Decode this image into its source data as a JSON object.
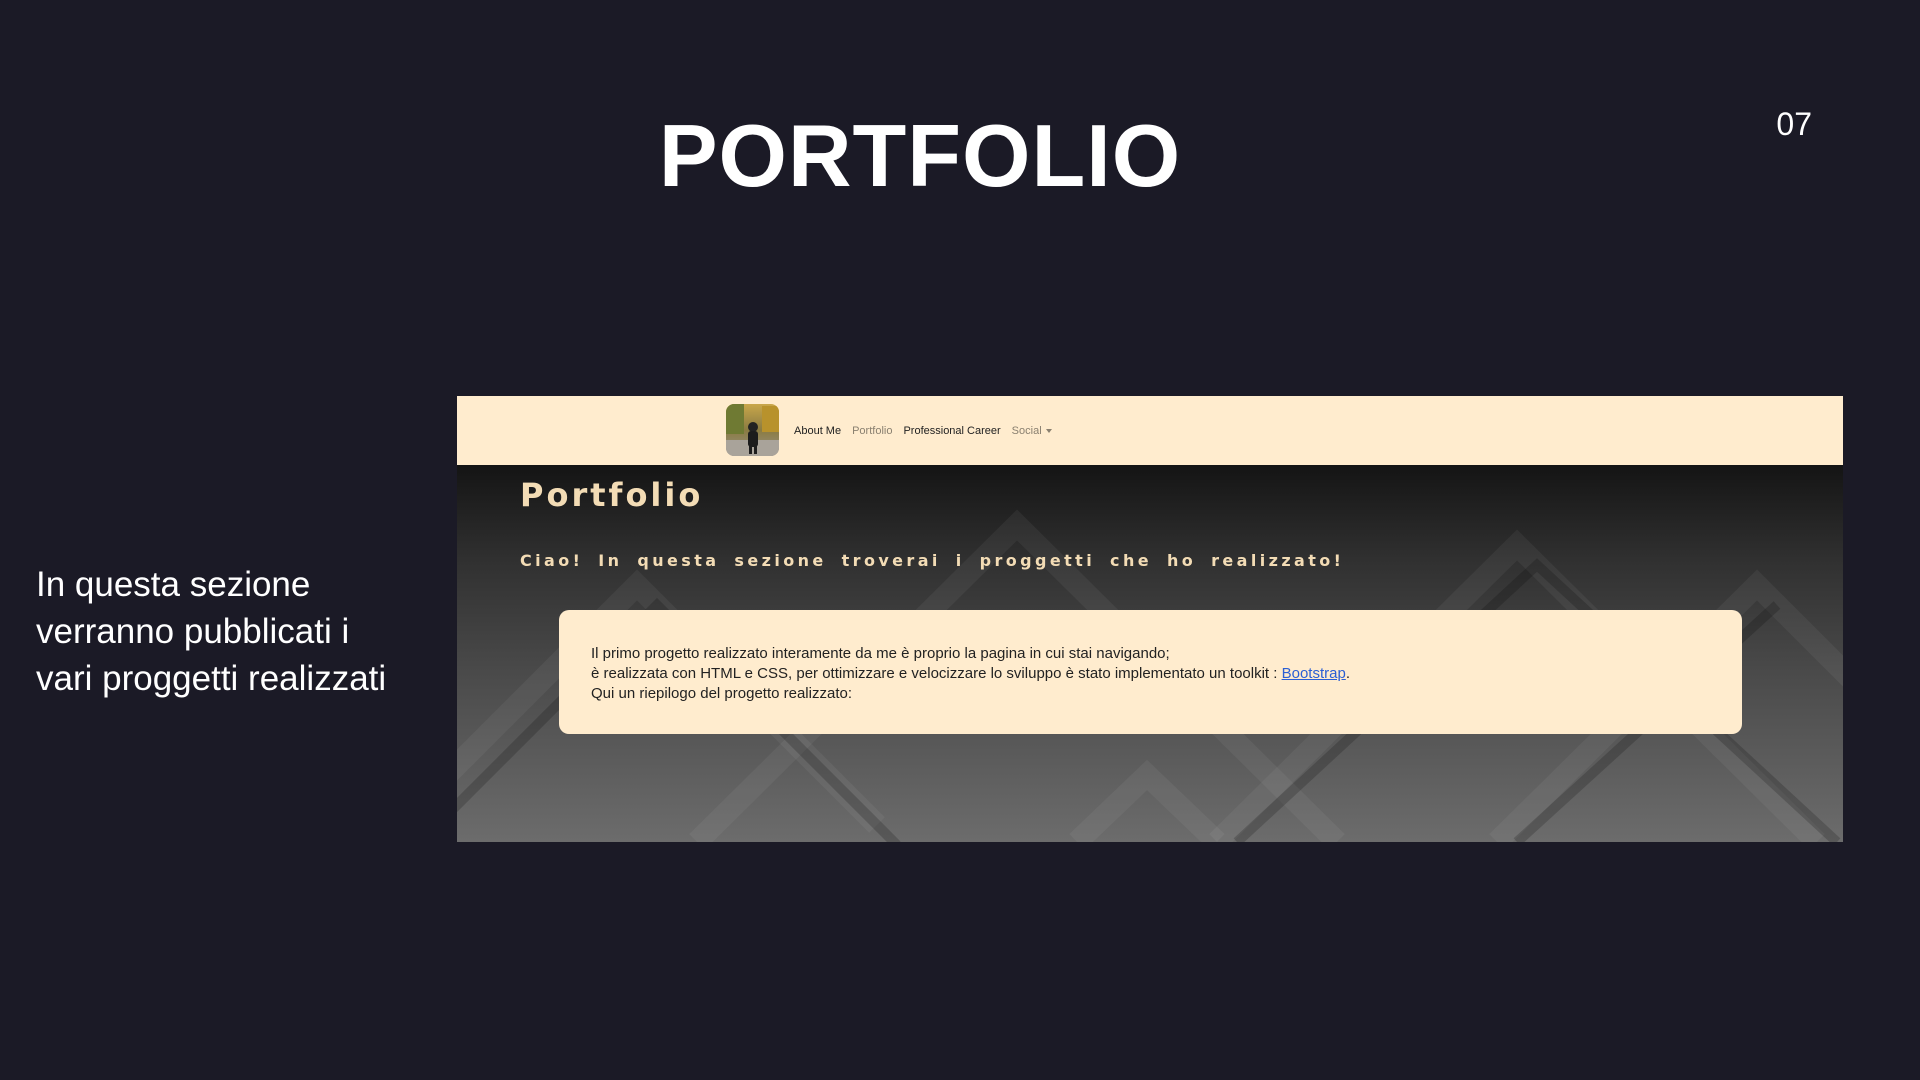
{
  "slide": {
    "title": "PORTFOLIO",
    "page_number": "07",
    "side_text_lines": [
      "In questa sezione",
      "verranno pubblicati i",
      "vari proggetti realizzati"
    ]
  },
  "website": {
    "nav": {
      "links": [
        {
          "label": "About Me"
        },
        {
          "label": "Portfolio"
        },
        {
          "label": "Professional Career"
        },
        {
          "label": "Social"
        }
      ]
    },
    "heading": "Portfolio",
    "subheading": "Ciao! In questa sezione troverai i proggetti che ho realizzato!",
    "card": {
      "line1": "Il primo progetto realizzato interamente da me è proprio la pagina in cui stai navigando;",
      "line2_prefix": "è realizzata con HTML e CSS, per ottimizzare e velocizzare lo sviluppo è stato implementato un toolkit : ",
      "link_label": "Bootstrap",
      "line2_suffix": ".",
      "line3": "Qui un riepilogo del progetto realizzato:"
    }
  },
  "colors": {
    "slide_background": "#1b1a26",
    "nav_background": "#ffecce",
    "accent_text": "#f3dcb5",
    "link": "#2b5fd4"
  },
  "icons": {
    "avatar": "profile-photo",
    "dropdown": "caret-down-icon"
  }
}
